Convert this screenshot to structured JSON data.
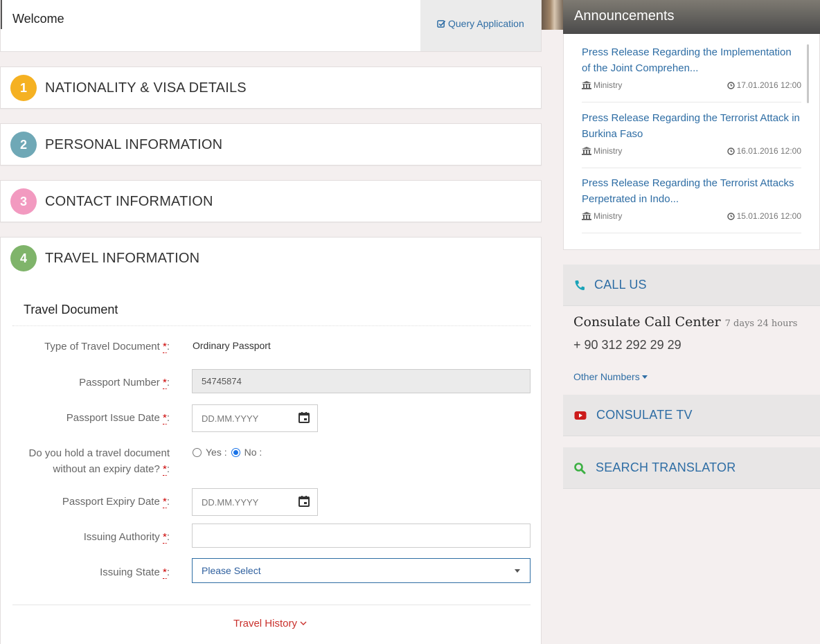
{
  "header": {
    "welcome": "Welcome",
    "query_label": "Query Application"
  },
  "sections": [
    {
      "number": "1",
      "title": "NATIONALITY & VISA DETAILS",
      "color": "#f5b122"
    },
    {
      "number": "2",
      "title": "PERSONAL INFORMATION",
      "color": "#6fa8b6"
    },
    {
      "number": "3",
      "title": "CONTACT INFORMATION",
      "color": "#f29ac0"
    },
    {
      "number": "4",
      "title": "TRAVEL INFORMATION",
      "color": "#7fb46a"
    }
  ],
  "travel": {
    "subhead": "Travel Document",
    "required_mark": "*",
    "doc_type_label": "Type of Travel Document",
    "doc_type_value": "Ordinary Passport",
    "passport_number_label": "Passport Number",
    "passport_number_value": "54745874",
    "issue_date_label": "Passport Issue Date",
    "issue_date_placeholder": "DD.MM.YYYY",
    "no_expiry_label_1": "Do you hold a travel document",
    "no_expiry_label_2": "without an expiry date?",
    "yes_label": "Yes :",
    "no_label": "No :",
    "no_expiry_selected": "No",
    "expiry_date_label": "Passport Expiry Date",
    "expiry_date_placeholder": "DD.MM.YYYY",
    "authority_label": "Issuing Authority",
    "authority_value": "",
    "state_label": "Issuing State",
    "state_value": "Please Select",
    "history_label": "Travel History"
  },
  "announcements": {
    "title": "Announcements",
    "items": [
      {
        "title": "Press Release Regarding the Implementation of the Joint Comprehen...",
        "source": "Ministry",
        "date": "17.01.2016 12:00"
      },
      {
        "title": "Press Release Regarding the Terrorist Attack in Burkina Faso",
        "source": "Ministry",
        "date": "16.01.2016 12:00"
      },
      {
        "title": "Press Release Regarding the Terrorist Attacks Perpetrated in Indo...",
        "source": "Ministry",
        "date": "15.01.2016 12:00"
      }
    ]
  },
  "call": {
    "title": "CALL US",
    "center": "Consulate Call Center",
    "hours": "7 days 24 hours",
    "phone": "+ 90 312 292 29 29",
    "other": "Other Numbers"
  },
  "tv": {
    "title": "CONSULATE TV"
  },
  "translator": {
    "title": "SEARCH TRANSLATOR"
  }
}
